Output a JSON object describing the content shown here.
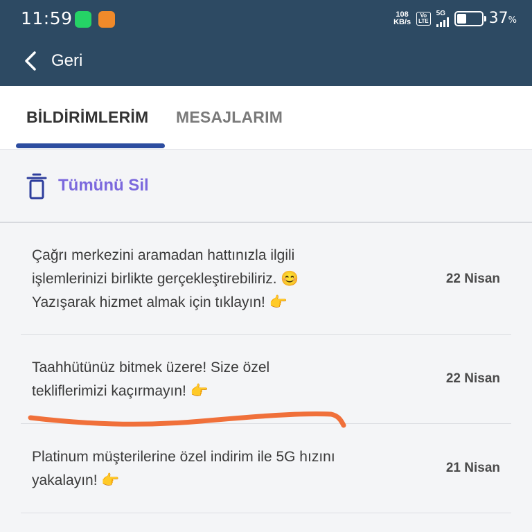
{
  "status_bar": {
    "time": "11:59",
    "speed_value": "108",
    "speed_unit": "KB/s",
    "volte_top": "Vo",
    "volte_bottom": "LTE",
    "network": "5G",
    "battery_percent": "37",
    "battery_unit": "%",
    "battery_level": 0.37
  },
  "header": {
    "back_label": "Geri"
  },
  "tabs": [
    {
      "label": "BİLDİRİMLERİM",
      "active": true
    },
    {
      "label": "MESAJLARIM",
      "active": false
    }
  ],
  "toolbar": {
    "delete_all_label": "Tümünü Sil"
  },
  "notifications": [
    {
      "lines": [
        "Çağrı merkezini aramadan hattınızla ilgili",
        "işlemlerinizi birlikte gerçekleştirebiliriz. 😊",
        "Yazışarak hizmet almak için tıklayın! 👉"
      ],
      "date": "22 Nisan"
    },
    {
      "lines": [
        "Taahhütünüz bitmek üzere! Size özel",
        "tekliflerimizi kaçırmayın! 👉"
      ],
      "date": "22 Nisan"
    },
    {
      "lines": [
        "Platinum müşterilerine özel indirim ile 5G hızını",
        "yakalayın! 👉"
      ],
      "date": "21 Nisan"
    }
  ],
  "colors": {
    "header_bg": "#2d4a63",
    "tab_indicator": "#2d4da0",
    "accent_purple": "#7b68dd",
    "scribble": "#f0703a"
  }
}
